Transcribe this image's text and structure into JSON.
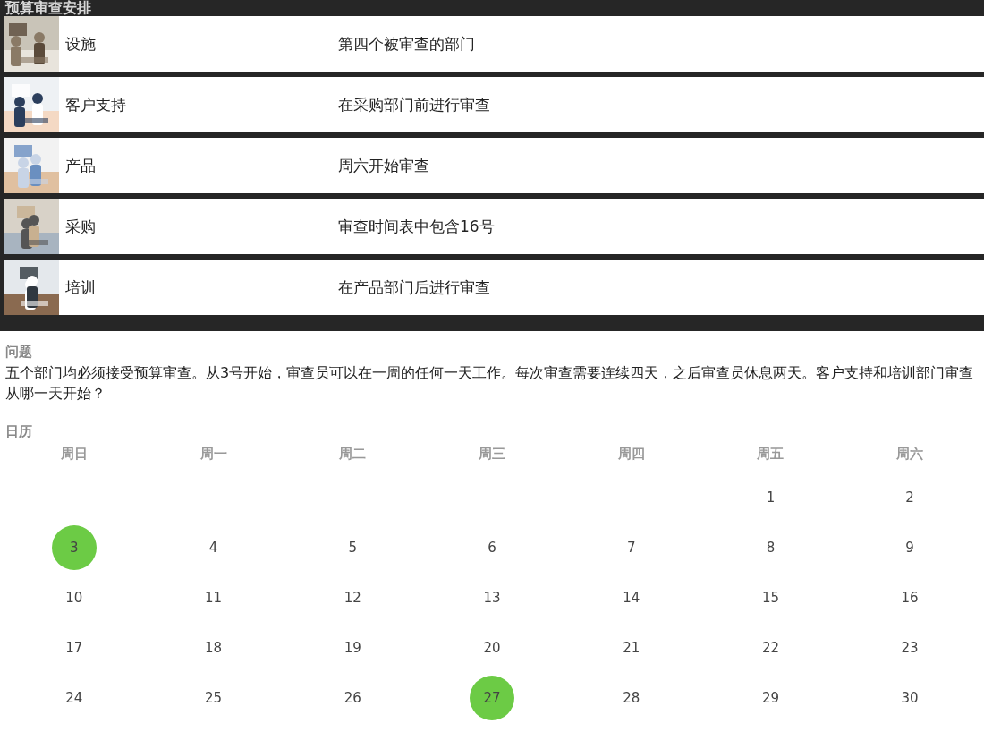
{
  "header": {
    "title": "预算审查安排"
  },
  "departments": [
    {
      "name": "设施",
      "clue": "第四个被审查的部门"
    },
    {
      "name": "客户支持",
      "clue": "在采购部门前进行审查"
    },
    {
      "name": "产品",
      "clue": "周六开始审查"
    },
    {
      "name": "采购",
      "clue": "审查时间表中包含16号"
    },
    {
      "name": "培训",
      "clue": "在产品部门后进行审查"
    }
  ],
  "question": {
    "label": "问题",
    "text": "五个部门均必须接受预算审查。从3号开始，审查员可以在一周的任何一天工作。每次审查需要连续四天，之后审查员休息两天。客户支持和培训部门审查从哪一天开始？"
  },
  "calendar": {
    "label": "日历",
    "weekdays": [
      "周日",
      "周一",
      "周二",
      "周三",
      "周四",
      "周五",
      "周六"
    ],
    "weeks": [
      [
        {
          "day": "1",
          "selected": false
        },
        {
          "day": "2",
          "selected": false
        }
      ],
      [
        {
          "day": "3",
          "selected": true
        },
        {
          "day": "4",
          "selected": false
        },
        {
          "day": "5",
          "selected": false
        },
        {
          "day": "6",
          "selected": false
        },
        {
          "day": "7",
          "selected": false
        },
        {
          "day": "8",
          "selected": false
        },
        {
          "day": "9",
          "selected": false
        }
      ],
      [
        {
          "day": "10",
          "selected": false
        },
        {
          "day": "11",
          "selected": false
        },
        {
          "day": "12",
          "selected": false
        },
        {
          "day": "13",
          "selected": false
        },
        {
          "day": "14",
          "selected": false
        },
        {
          "day": "15",
          "selected": false
        },
        {
          "day": "16",
          "selected": false
        }
      ],
      [
        {
          "day": "17",
          "selected": false
        },
        {
          "day": "18",
          "selected": false
        },
        {
          "day": "19",
          "selected": false
        },
        {
          "day": "20",
          "selected": false
        },
        {
          "day": "21",
          "selected": false
        },
        {
          "day": "22",
          "selected": false
        },
        {
          "day": "23",
          "selected": false
        }
      ],
      [
        {
          "day": "24",
          "selected": false
        },
        {
          "day": "25",
          "selected": false
        },
        {
          "day": "26",
          "selected": false
        },
        {
          "day": "27",
          "selected": true
        },
        {
          "day": "28",
          "selected": false
        },
        {
          "day": "29",
          "selected": false
        },
        {
          "day": "30",
          "selected": false
        }
      ]
    ]
  }
}
